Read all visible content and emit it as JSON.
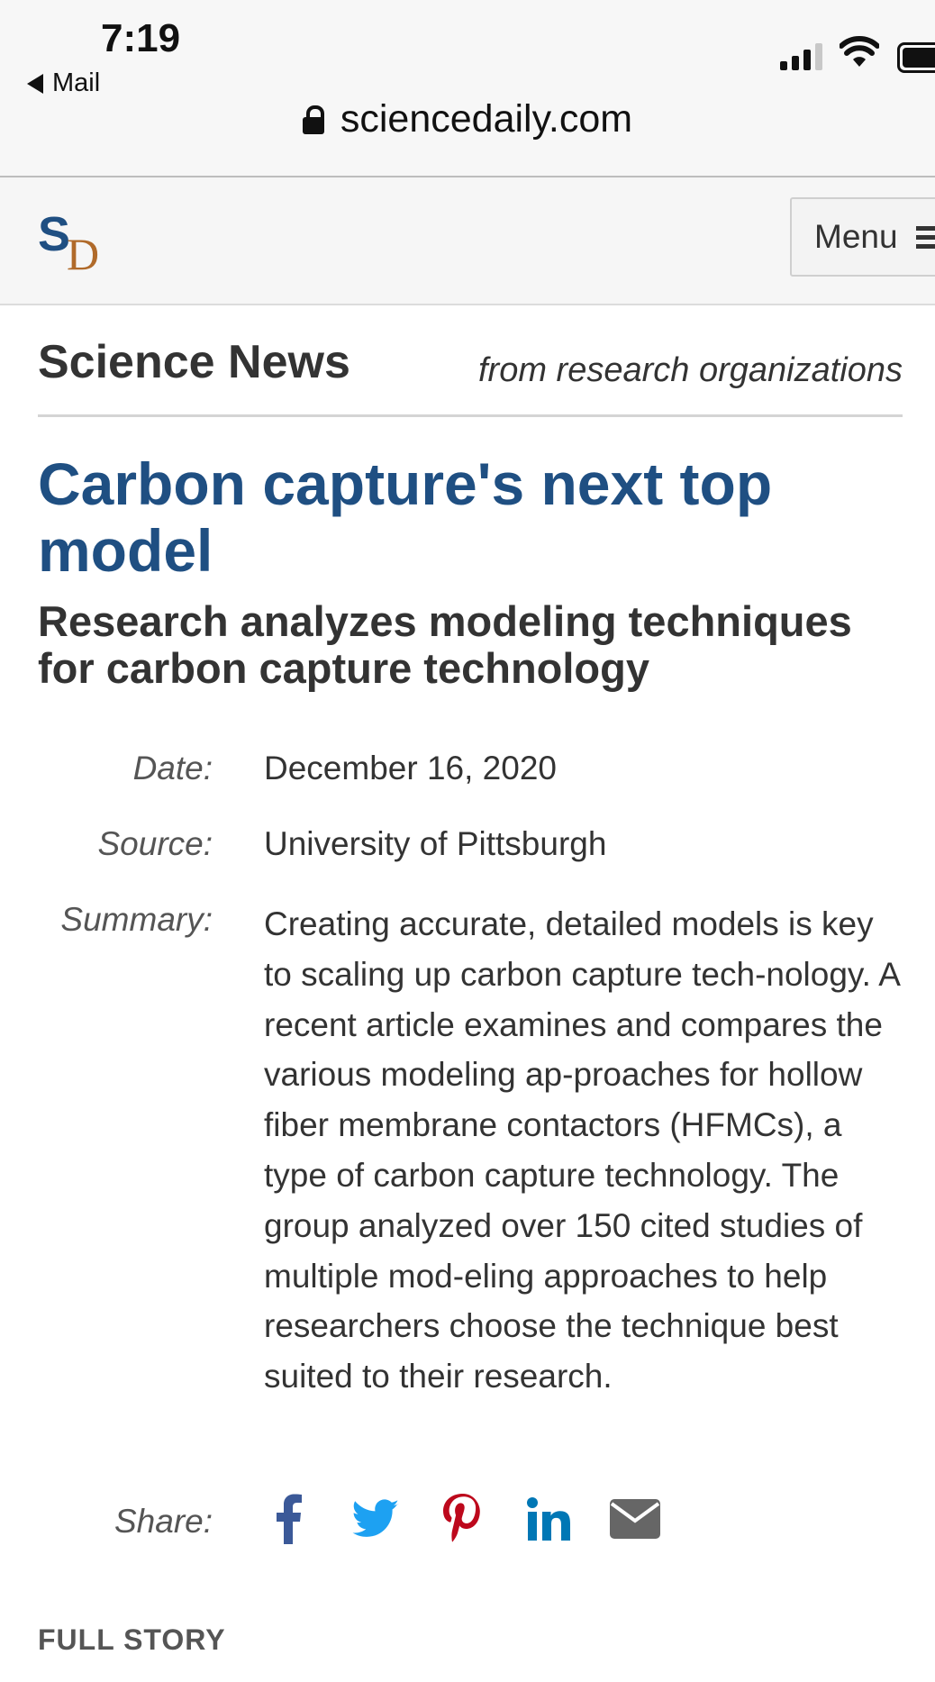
{
  "status_bar": {
    "time": "7:19",
    "back_label": "Mail",
    "url": "sciencedaily.com"
  },
  "site_header": {
    "logo_s": "S",
    "logo_d": "D",
    "menu_label": "Menu"
  },
  "section": {
    "title": "Science News",
    "subtitle": "from research organizations"
  },
  "article": {
    "headline": "Carbon capture's next top model",
    "subhead": "Research analyzes modeling techniques for carbon capture technology",
    "date_label": "Date:",
    "date": "December 16, 2020",
    "source_label": "Source:",
    "source": "University of Pittsburgh",
    "summary_label": "Summary:",
    "summary": "Creating accurate, detailed models is key to scaling up carbon capture tech-nology. A recent article examines and compares the various modeling ap-proaches for hollow fiber membrane contactors (HFMCs), a type of carbon capture technology. The group analyzed over 150 cited studies of multiple mod-eling approaches to help researchers choose the technique best suited to their research.",
    "share_label": "Share:",
    "full_story_label": "FULL STORY"
  },
  "share_icons": [
    {
      "name": "facebook-icon",
      "color": "#3b5998"
    },
    {
      "name": "twitter-icon",
      "color": "#1da1f2"
    },
    {
      "name": "pinterest-icon",
      "color": "#bd081c"
    },
    {
      "name": "linkedin-icon",
      "color": "#0077b5"
    },
    {
      "name": "email-icon",
      "color": "#666666"
    }
  ],
  "colors": {
    "brand_blue": "#1f4f82",
    "logo_accent": "#b06a2a"
  }
}
